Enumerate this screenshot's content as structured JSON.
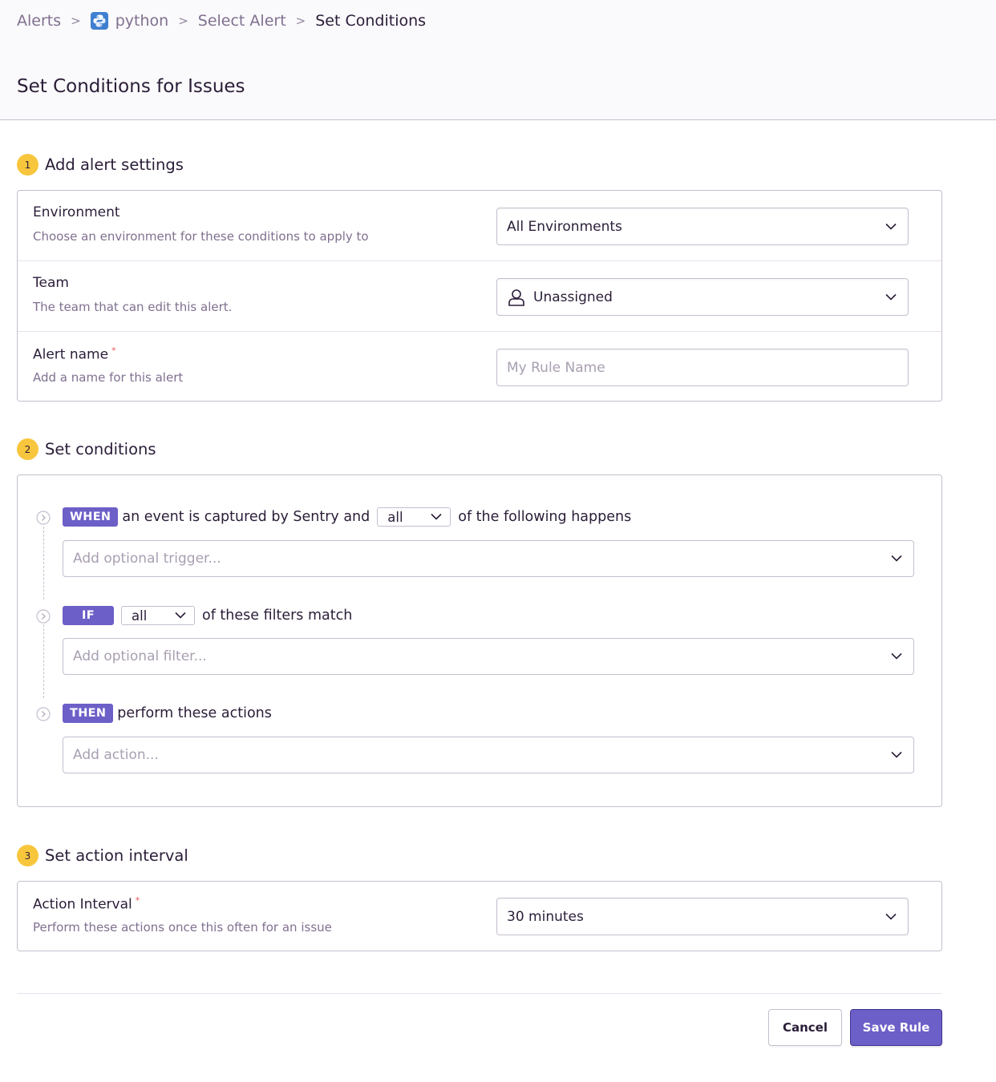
{
  "breadcrumb": {
    "alerts": "Alerts",
    "project": "python",
    "select_alert": "Select Alert",
    "current": "Set Conditions"
  },
  "page_title": "Set Conditions for Issues",
  "colors": {
    "accent": "#6c5fc7",
    "step_badge": "#f8c63d",
    "required": "#f55459",
    "python_icon": "#3f7fd0"
  },
  "steps": {
    "settings": {
      "number": "1",
      "title": "Add alert settings",
      "environment": {
        "label": "Environment",
        "help": "Choose an environment for these conditions to apply to",
        "value": "All Environments"
      },
      "team": {
        "label": "Team",
        "help": "The team that can edit this alert.",
        "value": "Unassigned"
      },
      "alert_name": {
        "label": "Alert name",
        "required_mark": "*",
        "help": "Add a name for this alert",
        "placeholder": "My Rule Name",
        "value": ""
      }
    },
    "conditions": {
      "number": "2",
      "title": "Set conditions",
      "when": {
        "tag": "WHEN",
        "prefix": "an event is captured by Sentry and",
        "match": "all",
        "suffix": "of the following happens",
        "placeholder": "Add optional trigger..."
      },
      "if": {
        "tag": "IF",
        "match": "all",
        "suffix": "of these filters match",
        "placeholder": "Add optional filter..."
      },
      "then": {
        "tag": "THEN",
        "suffix": "perform these actions",
        "placeholder": "Add action..."
      }
    },
    "interval": {
      "number": "3",
      "title": "Set action interval",
      "action_interval": {
        "label": "Action Interval",
        "required_mark": "*",
        "help": "Perform these actions once this often for an issue",
        "value": "30 minutes"
      }
    }
  },
  "buttons": {
    "cancel": "Cancel",
    "save": "Save Rule"
  }
}
